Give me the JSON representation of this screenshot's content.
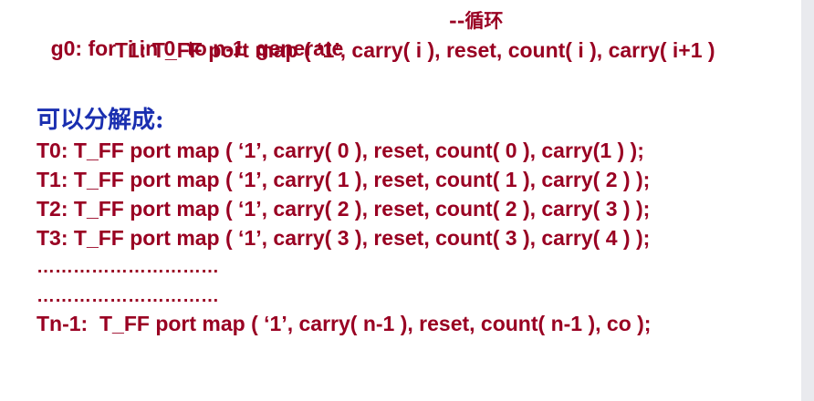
{
  "code_top": {
    "line1_code": "g0: for  i in 0  to n-1  generate",
    "line1_comment": "--循环",
    "line2": "T1: T_FF port map ( ‘1’, carry( i ), reset, count( i ), carry( i+1 )"
  },
  "heading": "可以分解成:",
  "expansion": [
    "T0: T_FF port map ( ‘1’, carry( 0 ), reset, count( 0 ), carry(1 ) );",
    "T1: T_FF port map ( ‘1’, carry( 1 ), reset, count( 1 ), carry( 2 ) );",
    "T2: T_FF port map ( ‘1’, carry( 2 ), reset, count( 2 ), carry( 3 ) );",
    "T3: T_FF port map ( ‘1’, carry( 3 ), reset, count( 3 ), carry( 4 ) );",
    "…………………………",
    "…………………………",
    "Tn-1:  T_FF port map ( ‘1’, carry( n-1 ), reset, count( n-1 ), co );"
  ],
  "colors": {
    "code": "#990022",
    "heading": "#1a2fb0",
    "background": "#ffffff",
    "side_strip": "#e9eaee"
  }
}
